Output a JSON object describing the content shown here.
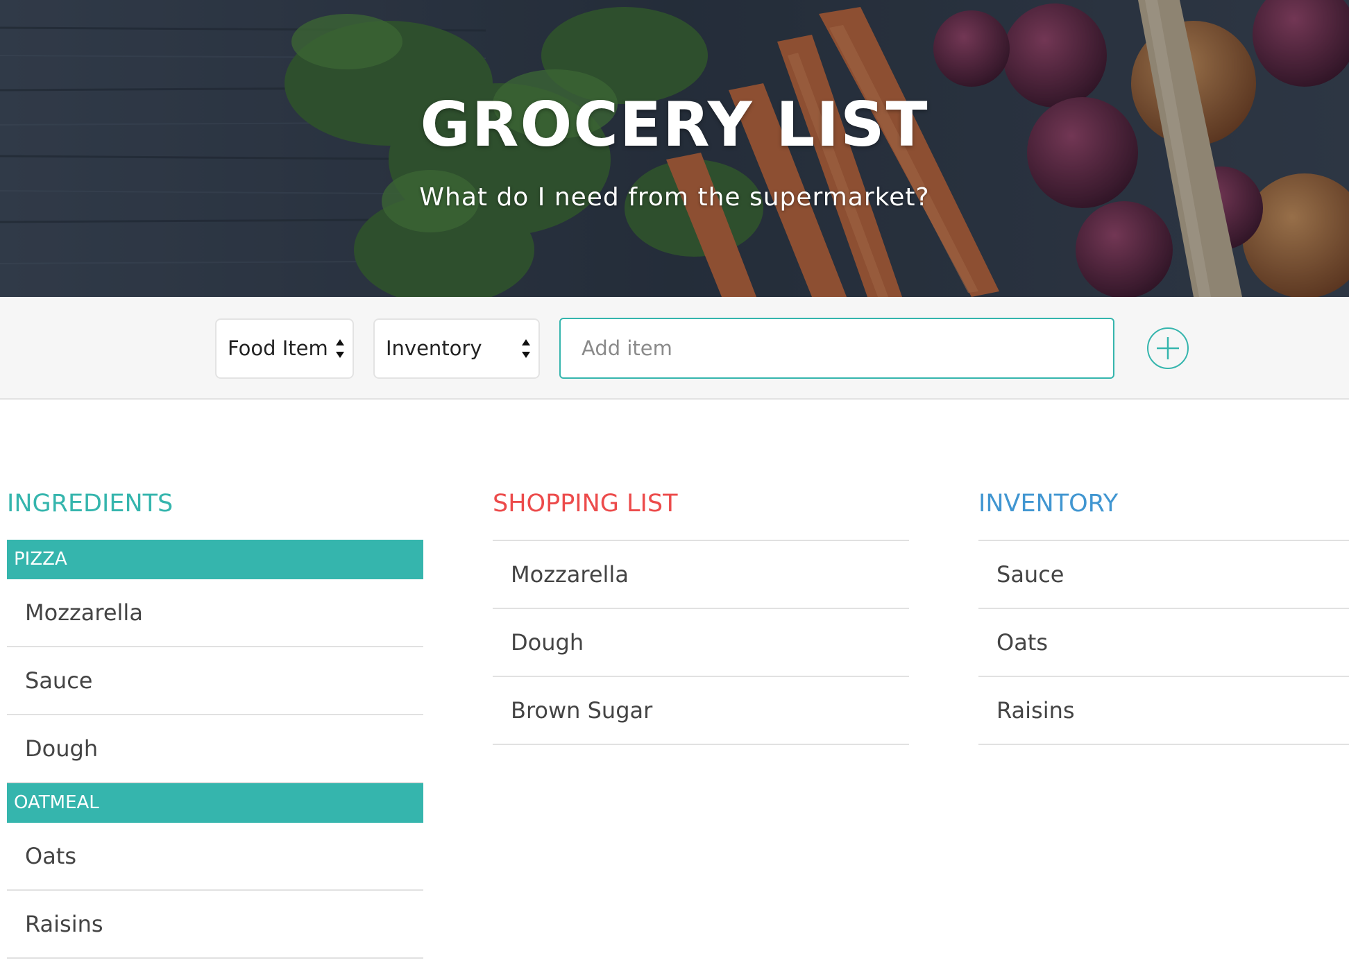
{
  "header": {
    "title": "GROCERY LIST",
    "subtitle": "What do I need from the supermarket?"
  },
  "toolbar": {
    "type_select": {
      "selected": "Food Item"
    },
    "list_select": {
      "selected": "Inventory"
    },
    "add_input": {
      "placeholder": "Add item",
      "value": ""
    },
    "add_button_icon": "plus-circle-icon"
  },
  "colors": {
    "teal": "#35b5ad",
    "red": "#ec4b4b",
    "blue": "#4196d1"
  },
  "ingredients": {
    "heading": "INGREDIENTS",
    "groups": [
      {
        "name": "PIZZA",
        "items": [
          "Mozzarella",
          "Sauce",
          "Dough"
        ]
      },
      {
        "name": "OATMEAL",
        "items": [
          "Oats",
          "Raisins"
        ]
      }
    ]
  },
  "shopping_list": {
    "heading": "SHOPPING LIST",
    "items": [
      "Mozzarella",
      "Dough",
      "Brown Sugar"
    ]
  },
  "inventory": {
    "heading": "INVENTORY",
    "items": [
      "Sauce",
      "Oats",
      "Raisins"
    ]
  }
}
